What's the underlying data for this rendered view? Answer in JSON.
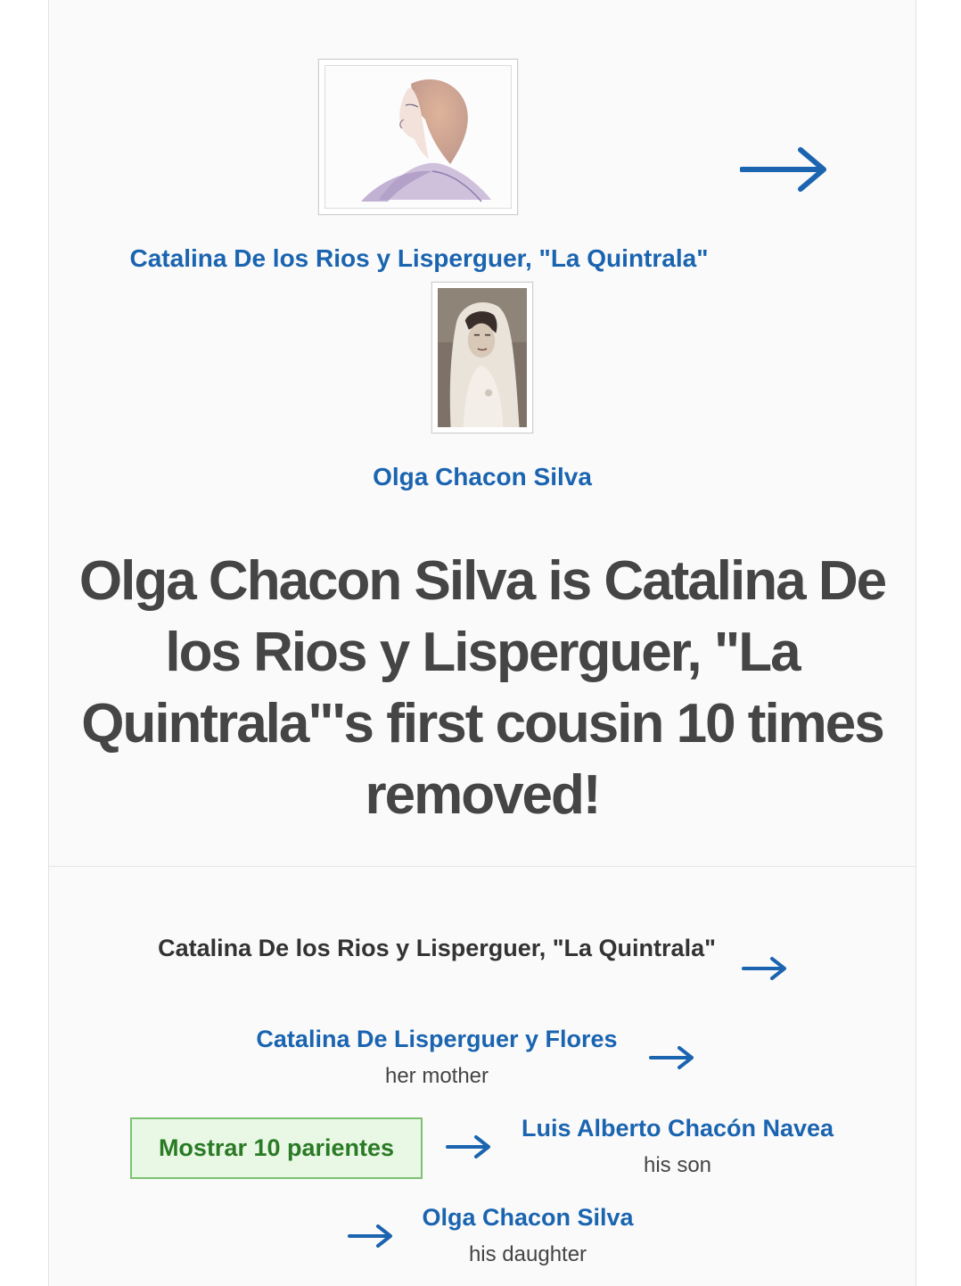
{
  "person_a": {
    "name": "Catalina De los Rios y Lisperguer, \"La Quintrala\""
  },
  "person_b": {
    "name": "Olga Chacon Silva"
  },
  "headline": "Olga Chacon Silva is Catalina De los Rios y Lisperguer, \"La Quintrala\"'s first cousin 10 times removed!",
  "path": {
    "start_name": "Catalina De los Rios y Lisperguer, \"La Quintrala\"",
    "steps": [
      {
        "name": "Catalina De Lisperguer y Flores",
        "relation": "her mother"
      },
      {
        "name": "Luis Alberto Chacón Navea",
        "relation": "his son"
      },
      {
        "name": "Olga Chacon Silva",
        "relation": "his daughter"
      }
    ],
    "show_relatives_label": "Mostrar 10 parientes"
  },
  "colors": {
    "link": "#1a64b0",
    "headline": "#454545",
    "button_bg": "#e8f8e4",
    "button_border": "#7cc272",
    "button_text": "#2a7a26"
  },
  "icons": {
    "arrow": "right-arrow-icon"
  }
}
